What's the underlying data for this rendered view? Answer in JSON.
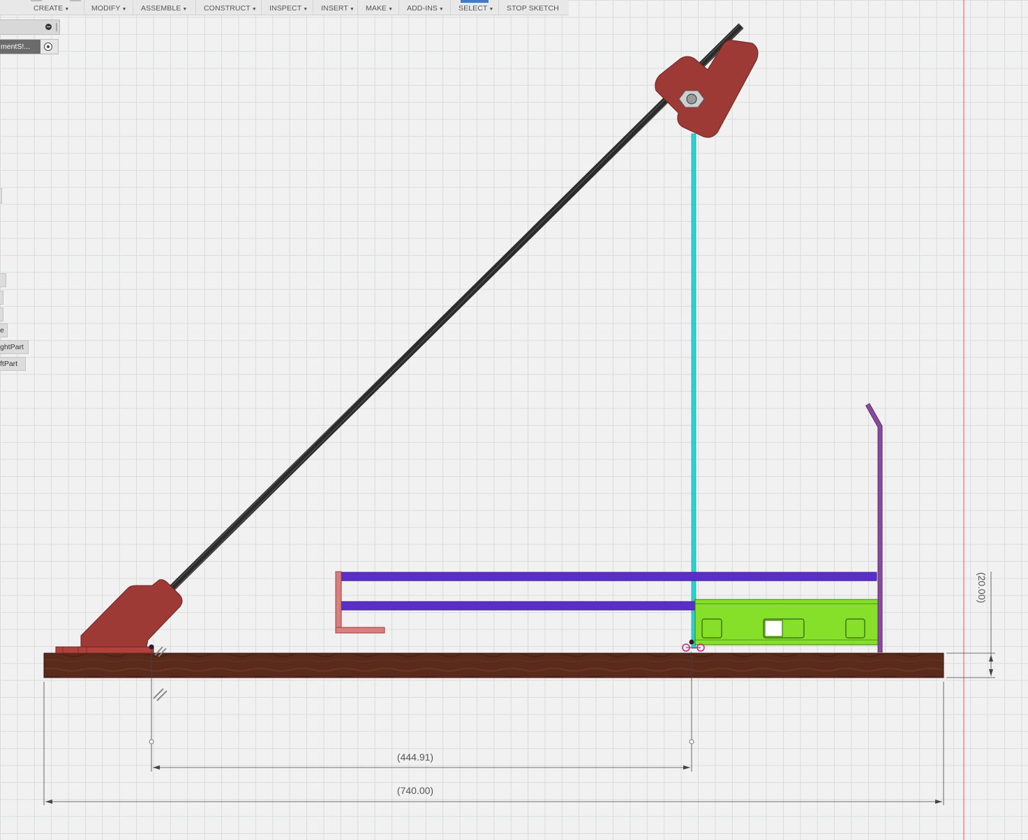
{
  "toolbar": {
    "menus": [
      {
        "label": "CREATE",
        "caret": "▼"
      },
      {
        "label": "MODIFY",
        "caret": "▼"
      },
      {
        "label": "ASSEMBLE",
        "caret": "▼"
      },
      {
        "label": "CONSTRUCT",
        "caret": "▼"
      },
      {
        "label": "INSPECT",
        "caret": "▼"
      },
      {
        "label": "INSERT",
        "caret": "▼"
      },
      {
        "label": "MAKE",
        "caret": "▼"
      },
      {
        "label": "ADD-INS",
        "caret": "▼"
      },
      {
        "label": "SELECT",
        "caret": "▼"
      }
    ],
    "stop_sketch": "STOP SKETCH",
    "active_color": "#3e7ac8"
  },
  "browser": {
    "component_label": "mentS!...",
    "items": [
      "e",
      "ghtPart",
      "ftPart"
    ]
  },
  "dimensions": {
    "d1": "(444.91)",
    "d2": "(740.00)",
    "d3": "(20.00)"
  },
  "colors": {
    "background": "#f1f1f1",
    "grid": "#d9dcdf",
    "bracket": "#9e3a36",
    "rod": "#2b2b2b",
    "tube": "#5a2fc9",
    "cyan_post": "#2ad3d0",
    "green_part": "#86e02a",
    "purple_rod": "#8a4a9c",
    "base_board": "#5a2a1d",
    "dim_line": "#444444",
    "red_axis": "#d45a5a"
  },
  "icons": [
    "minus-circle-icon",
    "radio-icon",
    "hex-nut-icon",
    "coincident-constraint-icon",
    "parallel-constraint-icon"
  ]
}
